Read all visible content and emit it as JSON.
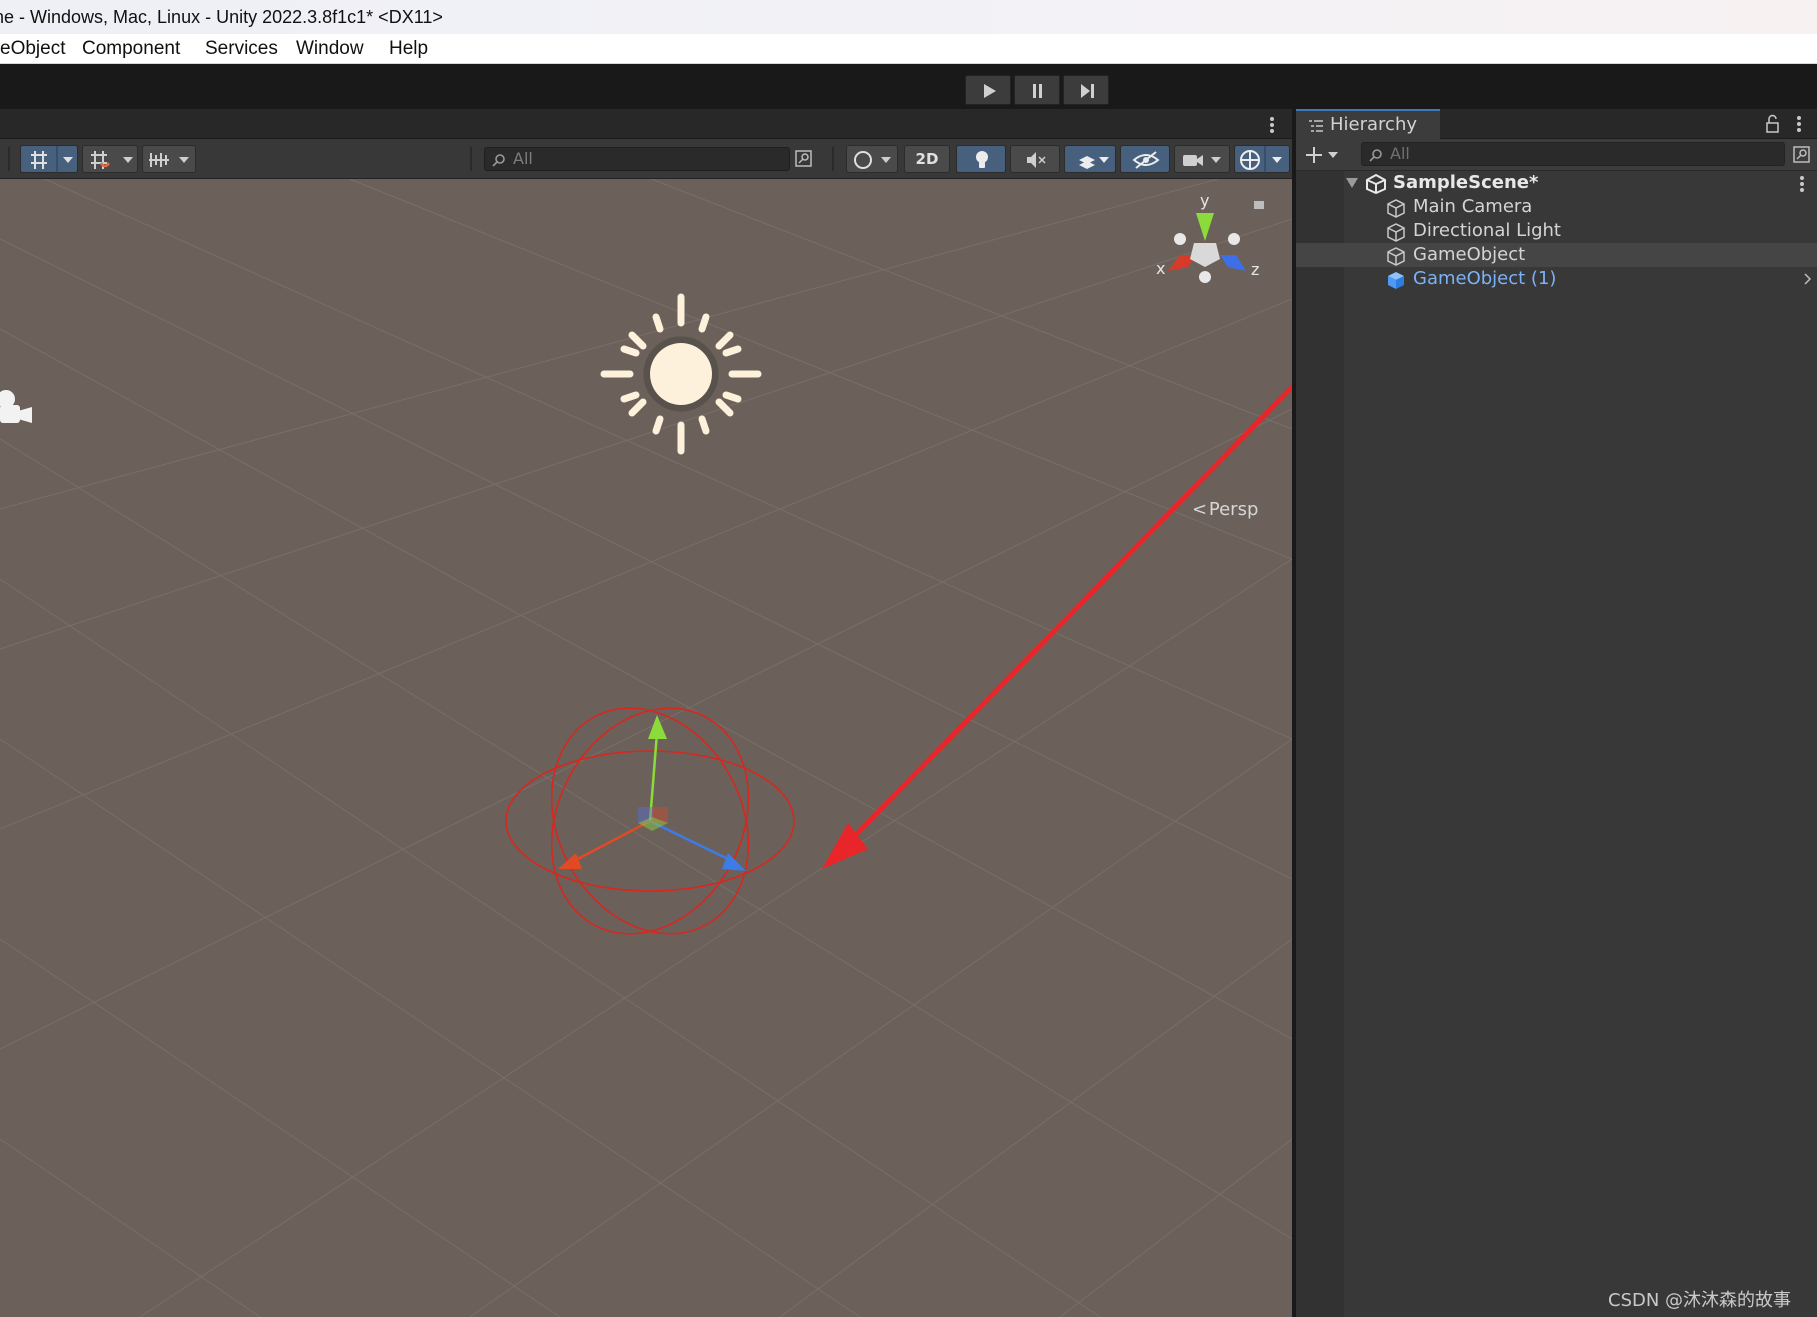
{
  "window": {
    "title": "ne - Windows, Mac, Linux - Unity 2022.3.8f1c1* <DX11>"
  },
  "menu": {
    "items": [
      "eObject",
      "Component",
      "Services",
      "Window",
      "Help"
    ]
  },
  "scene": {
    "search_placeholder": "All",
    "mode_2d_label": "2D",
    "persp_label": "Persp",
    "gizmo_axes": {
      "x": "x",
      "y": "y",
      "z": "z"
    }
  },
  "hierarchy": {
    "tab_label": "Hierarchy",
    "search_placeholder": "All",
    "scene_name": "SampleScene*",
    "items": [
      {
        "label": "Main Camera",
        "selected_style": false
      },
      {
        "label": "Directional Light",
        "selected_style": false
      },
      {
        "label": "GameObject",
        "selected_style": false
      },
      {
        "label": "GameObject (1)",
        "selected_style": true
      }
    ]
  },
  "colors": {
    "accent_blue": "#46607e",
    "prefab_blue": "#7cb2f5",
    "annotation_red": "#e8262a",
    "viewport_bg": "#6b615a"
  },
  "watermark": "CSDN @沐沐森的故事"
}
